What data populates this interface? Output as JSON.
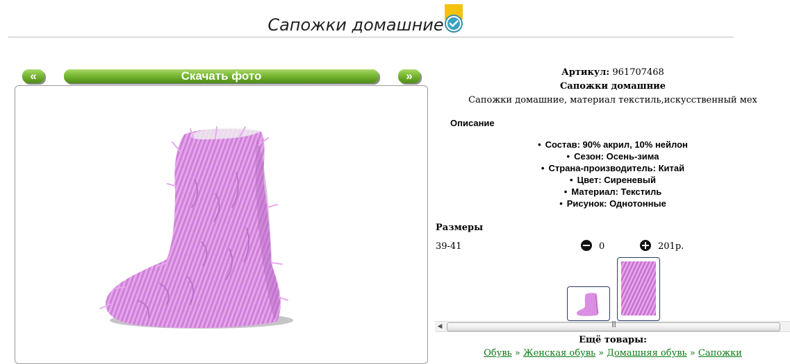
{
  "page": {
    "title": "Сапожки домашние",
    "badge_icon": "verified-check-icon"
  },
  "gallery": {
    "prev_label": "«",
    "download_label": "Скачать фото",
    "next_label": "»",
    "button_color": "#6aaa2a"
  },
  "product": {
    "article_label": "Артикул:",
    "article_value": "961707468",
    "name": "Сапожки домашние",
    "short_description": "Сапожки домашние, материал текстиль,искусственный мех",
    "description_title": "Описание",
    "features": [
      "Состав: 90% акрил, 10% нейлон",
      "Сезон: Осень-зима",
      "Страна-производитель: Китай",
      "Цвет: Сиреневый",
      "Материал: Текстиль",
      "Рисунок: Однотонные"
    ],
    "sizes_label": "Размеры",
    "size": "39-41",
    "quantity": "0",
    "price": "201р.",
    "color_accent": "#d98fe0"
  },
  "more": {
    "label": "Ещё товары:",
    "breadcrumb": [
      "Обувь",
      "Женская обувь",
      "Домашняя обувь",
      "Сапожки"
    ],
    "separator": "»",
    "link_color": "#0a7a14"
  }
}
